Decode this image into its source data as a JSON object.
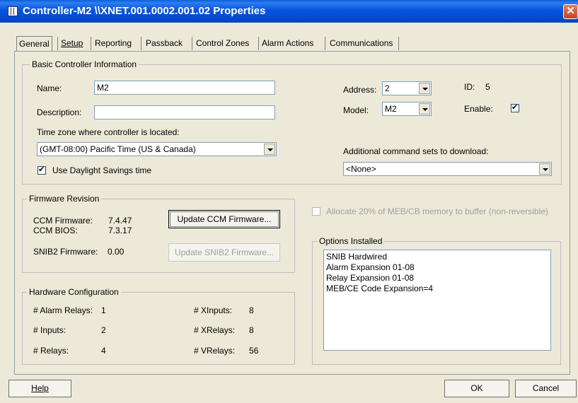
{
  "window": {
    "title": "Controller-M2 \\\\XNET.001.0002.001.02 Properties",
    "close_glyph": "✕"
  },
  "tabs": [
    {
      "label": "General"
    },
    {
      "label": "Setup"
    },
    {
      "label": "Reporting"
    },
    {
      "label": "Passback"
    },
    {
      "label": "Control Zones"
    },
    {
      "label": "Alarm Actions"
    },
    {
      "label": "Communications"
    }
  ],
  "basic": {
    "legend": "Basic Controller Information",
    "name_label": "Name:",
    "name_value": "M2",
    "description_label": "Description:",
    "description_value": "",
    "timezone_label": "Time zone where controller is located:",
    "timezone_value": "(GMT-08:00) Pacific Time (US & Canada)",
    "dst_label": "Use Daylight Savings time",
    "dst_checked": true,
    "address_label": "Address:",
    "address_value": "2",
    "model_label": "Model:",
    "model_value": "M2",
    "id_label": "ID:",
    "id_value": "5",
    "enable_label": "Enable:",
    "enable_checked": true,
    "cmdsets_label": "Additional command sets to download:",
    "cmdsets_value": "<None>"
  },
  "firmware": {
    "legend": "Firmware Revision",
    "ccm_fw_label": "CCM Firmware:",
    "ccm_fw_value": "7.4.47",
    "ccm_bios_label": "CCM BIOS:",
    "ccm_bios_value": "7.3.17",
    "snib2_label": "SNIB2 Firmware:",
    "snib2_value": "0.00",
    "update_ccm_label": "Update CCM Firmware...",
    "update_snib2_label": "Update SNIB2 Firmware..."
  },
  "hardware": {
    "legend": "Hardware Configuration",
    "alarm_relays_label": "# Alarm Relays:",
    "alarm_relays_value": "1",
    "inputs_label": "# Inputs:",
    "inputs_value": "2",
    "relays_label": "# Relays:",
    "relays_value": "4",
    "xinputs_label": "# XInputs:",
    "xinputs_value": "8",
    "xrelays_label": "# XRelays:",
    "xrelays_value": "8",
    "vrelays_label": "# VRelays:",
    "vrelays_value": "56"
  },
  "allocate": {
    "label": "Allocate 20% of MEB/CB memory to buffer (non-reversible)",
    "checked": false
  },
  "options": {
    "legend": "Options Installed",
    "items": [
      "SNIB Hardwired",
      "Alarm Expansion 01-08",
      "Relay Expansion 01-08",
      "MEB/CE Code Expansion=4"
    ]
  },
  "footer": {
    "help_label": "Help",
    "ok_label": "OK",
    "cancel_label": "Cancel"
  }
}
